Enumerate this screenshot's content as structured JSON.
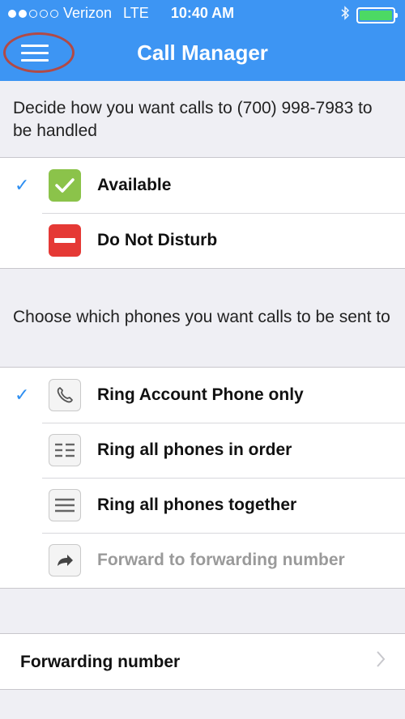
{
  "status_bar": {
    "carrier": "Verizon",
    "network": "LTE",
    "time": "10:40 AM",
    "battery_level": 1.0,
    "signal_bars_filled": 2,
    "signal_bars_total": 5
  },
  "header": {
    "title": "Call Manager",
    "menu_icon": "hamburger-menu-icon",
    "color": "#3d95f3"
  },
  "availability": {
    "prompt": "Decide how you want calls to (700) 998-7983 to be handled",
    "options": [
      {
        "label": "Available",
        "icon": "green-check-icon",
        "selected": true
      },
      {
        "label": "Do Not Disturb",
        "icon": "red-minus-icon",
        "selected": false
      }
    ]
  },
  "routing": {
    "prompt": "Choose which phones you want calls to be sent to",
    "options": [
      {
        "label": "Ring Account Phone only",
        "icon": "phone-handset-icon",
        "selected": true,
        "enabled": true
      },
      {
        "label": "Ring all phones in order",
        "icon": "ordered-list-icon",
        "selected": false,
        "enabled": true
      },
      {
        "label": "Ring all phones together",
        "icon": "list-icon",
        "selected": false,
        "enabled": true
      },
      {
        "label": "Forward to forwarding number",
        "icon": "forward-arrow-icon",
        "selected": false,
        "enabled": false
      }
    ]
  },
  "forwarding": {
    "label": "Forwarding number",
    "icon": "chevron-right-icon"
  },
  "colors": {
    "accent": "#2d8ef1",
    "available": "#8bc34a",
    "dnd": "#e53935",
    "battery": "#4cd964",
    "highlight_ring": "#b14a46"
  }
}
